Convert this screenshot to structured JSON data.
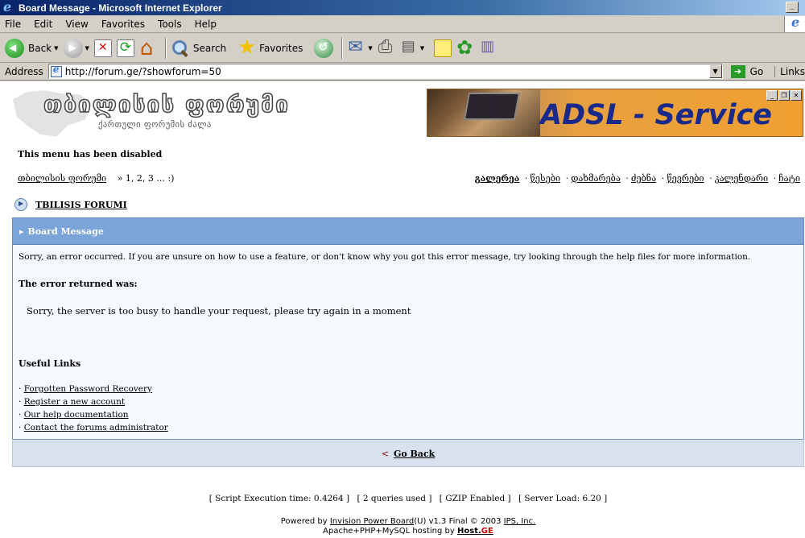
{
  "window": {
    "title": "Board Message - Microsoft Internet Explorer"
  },
  "menubar": {
    "items": [
      "File",
      "Edit",
      "View",
      "Favorites",
      "Tools",
      "Help"
    ]
  },
  "toolbar": {
    "back_label": "Back",
    "search_label": "Search",
    "favorites_label": "Favorites"
  },
  "addressbar": {
    "label": "Address",
    "url": "http://forum.ge/?showforum=50",
    "go_label": "Go",
    "links_label": "Links"
  },
  "page": {
    "logo_title": "თბილისის ფორუმი",
    "logo_subtitle": "ქართული ფორუმის ძალა",
    "banner_text": "ADSL - Service",
    "menu_disabled": "This menu has been disabled",
    "breadcrumb": {
      "link": "თბილისის ფორუმი",
      "pages": "» 1, 2, 3 ... :)"
    },
    "nav_links": [
      "გალერეა",
      "წესები",
      "დახმარება",
      "ძებნა",
      "წევრები",
      "კალენდარი",
      "ჩატი"
    ],
    "forum_title": "TBILISIS FORUMI",
    "board_message": {
      "header": "Board Message",
      "intro": "Sorry, an error occurred. If you are unsure on how to use a feature, or don't know why you got this error message, try looking through the help files for more information.",
      "error_title": "The error returned was:",
      "error_text": "Sorry, the server is too busy to handle your request, please try again in a moment",
      "useful_title": "Useful Links",
      "links": [
        "Forgotten Password Recovery",
        "Register a new account",
        "Our help documentation",
        "Contact the forums administrator"
      ]
    },
    "go_back": {
      "prefix": "<",
      "label": "Go Back"
    },
    "stats": [
      "[ Script Execution time: 0.4264 ]",
      "[ 2 queries used ]",
      "[ GZIP Enabled ]",
      "[ Server Load: 6.20 ]"
    ],
    "powered": {
      "prefix": "Powered by",
      "ipb_link": "Invision Power Board",
      "version": "(U) v1.3 Final © 2003",
      "company_link": "IPS, Inc.",
      "hosting_prefix": "Apache+PHP+MySQL hosting by",
      "host_main": "Host.",
      "host_ge": "GE"
    }
  }
}
